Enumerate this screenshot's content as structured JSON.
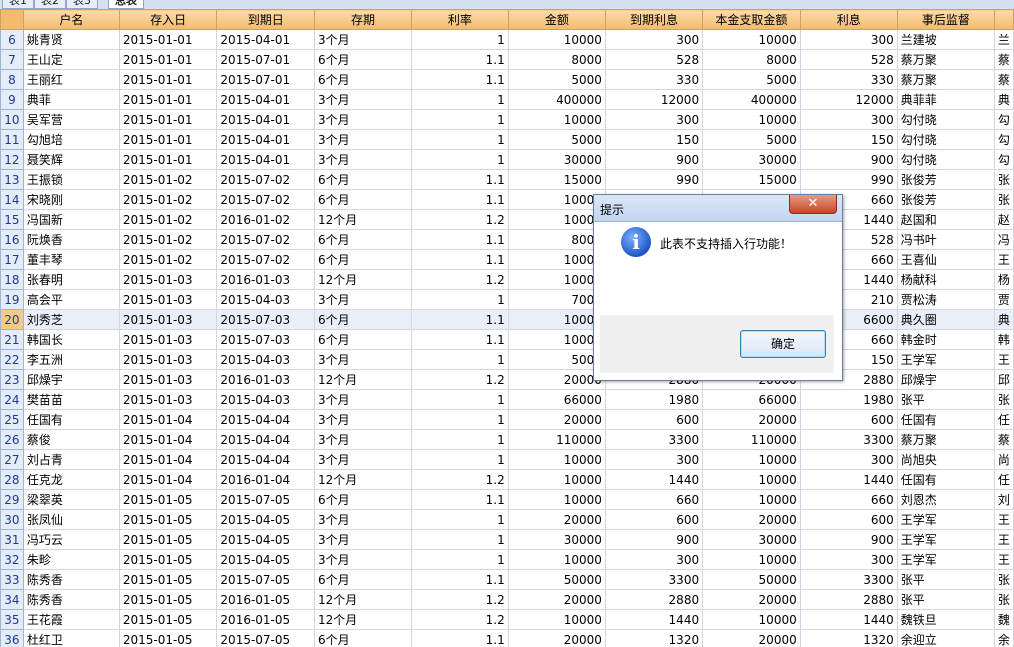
{
  "sheet_tabs": [
    {
      "label": "表1",
      "active": false
    },
    {
      "label": "表2",
      "active": false
    },
    {
      "label": "表3",
      "active": false
    },
    {
      "label": "总表",
      "active": true
    }
  ],
  "columns": [
    "户名",
    "存入日",
    "到期日",
    "存期",
    "利率",
    "金额",
    "到期利息",
    "本金支取金额",
    "利息",
    "事后监督",
    ""
  ],
  "selected_row": "20",
  "rows": [
    {
      "n": "6",
      "c": [
        "姚青贤",
        "2015-01-01",
        "2015-04-01",
        "3个月",
        "1",
        "10000",
        "300",
        "10000",
        "300",
        "兰建坡",
        "兰"
      ]
    },
    {
      "n": "7",
      "c": [
        "王山定",
        "2015-01-01",
        "2015-07-01",
        "6个月",
        "1.1",
        "8000",
        "528",
        "8000",
        "528",
        "蔡万聚",
        "蔡"
      ]
    },
    {
      "n": "8",
      "c": [
        "王丽红",
        "2015-01-01",
        "2015-07-01",
        "6个月",
        "1.1",
        "5000",
        "330",
        "5000",
        "330",
        "蔡万聚",
        "蔡"
      ]
    },
    {
      "n": "9",
      "c": [
        "典菲",
        "2015-01-01",
        "2015-04-01",
        "3个月",
        "1",
        "400000",
        "12000",
        "400000",
        "12000",
        "典菲菲",
        "典"
      ]
    },
    {
      "n": "10",
      "c": [
        "吴军营",
        "2015-01-01",
        "2015-04-01",
        "3个月",
        "1",
        "10000",
        "300",
        "10000",
        "300",
        "勾付晓",
        "勾"
      ]
    },
    {
      "n": "11",
      "c": [
        "勾旭培",
        "2015-01-01",
        "2015-04-01",
        "3个月",
        "1",
        "5000",
        "150",
        "5000",
        "150",
        "勾付晓",
        "勾"
      ]
    },
    {
      "n": "12",
      "c": [
        "聂笑辉",
        "2015-01-01",
        "2015-04-01",
        "3个月",
        "1",
        "30000",
        "900",
        "30000",
        "900",
        "勾付晓",
        "勾"
      ]
    },
    {
      "n": "13",
      "c": [
        "王振锁",
        "2015-01-02",
        "2015-07-02",
        "6个月",
        "1.1",
        "15000",
        "990",
        "15000",
        "990",
        "张俊芳",
        "张"
      ]
    },
    {
      "n": "14",
      "c": [
        "宋晓刚",
        "2015-01-02",
        "2015-07-02",
        "6个月",
        "1.1",
        "10000",
        "",
        "",
        "660",
        "张俊芳",
        "张"
      ]
    },
    {
      "n": "15",
      "c": [
        "冯国新",
        "2015-01-02",
        "2016-01-02",
        "12个月",
        "1.2",
        "10000",
        "",
        "",
        "1440",
        "赵国和",
        "赵"
      ]
    },
    {
      "n": "16",
      "c": [
        "阮焕香",
        "2015-01-02",
        "2015-07-02",
        "6个月",
        "1.1",
        "8000",
        "",
        "",
        "528",
        "冯书叶",
        "冯"
      ]
    },
    {
      "n": "17",
      "c": [
        "董丰琴",
        "2015-01-02",
        "2015-07-02",
        "6个月",
        "1.1",
        "10000",
        "",
        "",
        "660",
        "王喜仙",
        "王"
      ]
    },
    {
      "n": "18",
      "c": [
        "张春明",
        "2015-01-03",
        "2016-01-03",
        "12个月",
        "1.2",
        "10000",
        "",
        "",
        "1440",
        "杨献科",
        "杨"
      ]
    },
    {
      "n": "19",
      "c": [
        "高会平",
        "2015-01-03",
        "2015-04-03",
        "3个月",
        "1",
        "7000",
        "",
        "",
        "210",
        "贾松涛",
        "贾"
      ]
    },
    {
      "n": "20",
      "c": [
        "刘秀芝",
        "2015-01-03",
        "2015-07-03",
        "6个月",
        "1.1",
        "10000",
        "",
        "",
        "6600",
        "典久圈",
        "典"
      ]
    },
    {
      "n": "21",
      "c": [
        "韩国长",
        "2015-01-03",
        "2015-07-03",
        "6个月",
        "1.1",
        "10000",
        "",
        "",
        "660",
        "韩金时",
        "韩"
      ]
    },
    {
      "n": "22",
      "c": [
        "李五洲",
        "2015-01-03",
        "2015-04-03",
        "3个月",
        "1",
        "5000",
        "",
        "",
        "150",
        "王学军",
        "王"
      ]
    },
    {
      "n": "23",
      "c": [
        "邱燥宇",
        "2015-01-03",
        "2016-01-03",
        "12个月",
        "1.2",
        "20000",
        "2880",
        "20000",
        "2880",
        "邱燥宇",
        "邱"
      ]
    },
    {
      "n": "24",
      "c": [
        "樊苗苗",
        "2015-01-03",
        "2015-04-03",
        "3个月",
        "1",
        "66000",
        "1980",
        "66000",
        "1980",
        "张平",
        "张"
      ]
    },
    {
      "n": "25",
      "c": [
        "任国有",
        "2015-01-04",
        "2015-04-04",
        "3个月",
        "1",
        "20000",
        "600",
        "20000",
        "600",
        "任国有",
        "任"
      ]
    },
    {
      "n": "26",
      "c": [
        "蔡俊",
        "2015-01-04",
        "2015-04-04",
        "3个月",
        "1",
        "110000",
        "3300",
        "110000",
        "3300",
        "蔡万聚",
        "蔡"
      ]
    },
    {
      "n": "27",
      "c": [
        "刘占青",
        "2015-01-04",
        "2015-04-04",
        "3个月",
        "1",
        "10000",
        "300",
        "10000",
        "300",
        "尚旭央",
        "尚"
      ]
    },
    {
      "n": "28",
      "c": [
        "任克龙",
        "2015-01-04",
        "2016-01-04",
        "12个月",
        "1.2",
        "10000",
        "1440",
        "10000",
        "1440",
        "任国有",
        "任"
      ]
    },
    {
      "n": "29",
      "c": [
        "梁翠英",
        "2015-01-05",
        "2015-07-05",
        "6个月",
        "1.1",
        "10000",
        "660",
        "10000",
        "660",
        "刘恩杰",
        "刘"
      ]
    },
    {
      "n": "30",
      "c": [
        "张凤仙",
        "2015-01-05",
        "2015-04-05",
        "3个月",
        "1",
        "20000",
        "600",
        "20000",
        "600",
        "王学军",
        "王"
      ]
    },
    {
      "n": "31",
      "c": [
        "冯巧云",
        "2015-01-05",
        "2015-04-05",
        "3个月",
        "1",
        "30000",
        "900",
        "30000",
        "900",
        "王学军",
        "王"
      ]
    },
    {
      "n": "32",
      "c": [
        "朱畛",
        "2015-01-05",
        "2015-04-05",
        "3个月",
        "1",
        "10000",
        "300",
        "10000",
        "300",
        "王学军",
        "王"
      ]
    },
    {
      "n": "33",
      "c": [
        "陈秀香",
        "2015-01-05",
        "2015-07-05",
        "6个月",
        "1.1",
        "50000",
        "3300",
        "50000",
        "3300",
        "张平",
        "张"
      ]
    },
    {
      "n": "34",
      "c": [
        "陈秀香",
        "2015-01-05",
        "2016-01-05",
        "12个月",
        "1.2",
        "20000",
        "2880",
        "20000",
        "2880",
        "张平",
        "张"
      ]
    },
    {
      "n": "35",
      "c": [
        "王花霞",
        "2015-01-05",
        "2016-01-05",
        "12个月",
        "1.2",
        "10000",
        "1440",
        "10000",
        "1440",
        "魏铁旦",
        "魏"
      ]
    },
    {
      "n": "36",
      "c": [
        "杜红卫",
        "2015-01-05",
        "2015-07-05",
        "6个月",
        "1.1",
        "20000",
        "1320",
        "20000",
        "1320",
        "余迎立",
        "余"
      ]
    }
  ],
  "dialog": {
    "title": "提示",
    "close_label": "✕",
    "message": "此表不支持插入行功能！",
    "ok_label": "确定",
    "icon": "info-icon"
  }
}
